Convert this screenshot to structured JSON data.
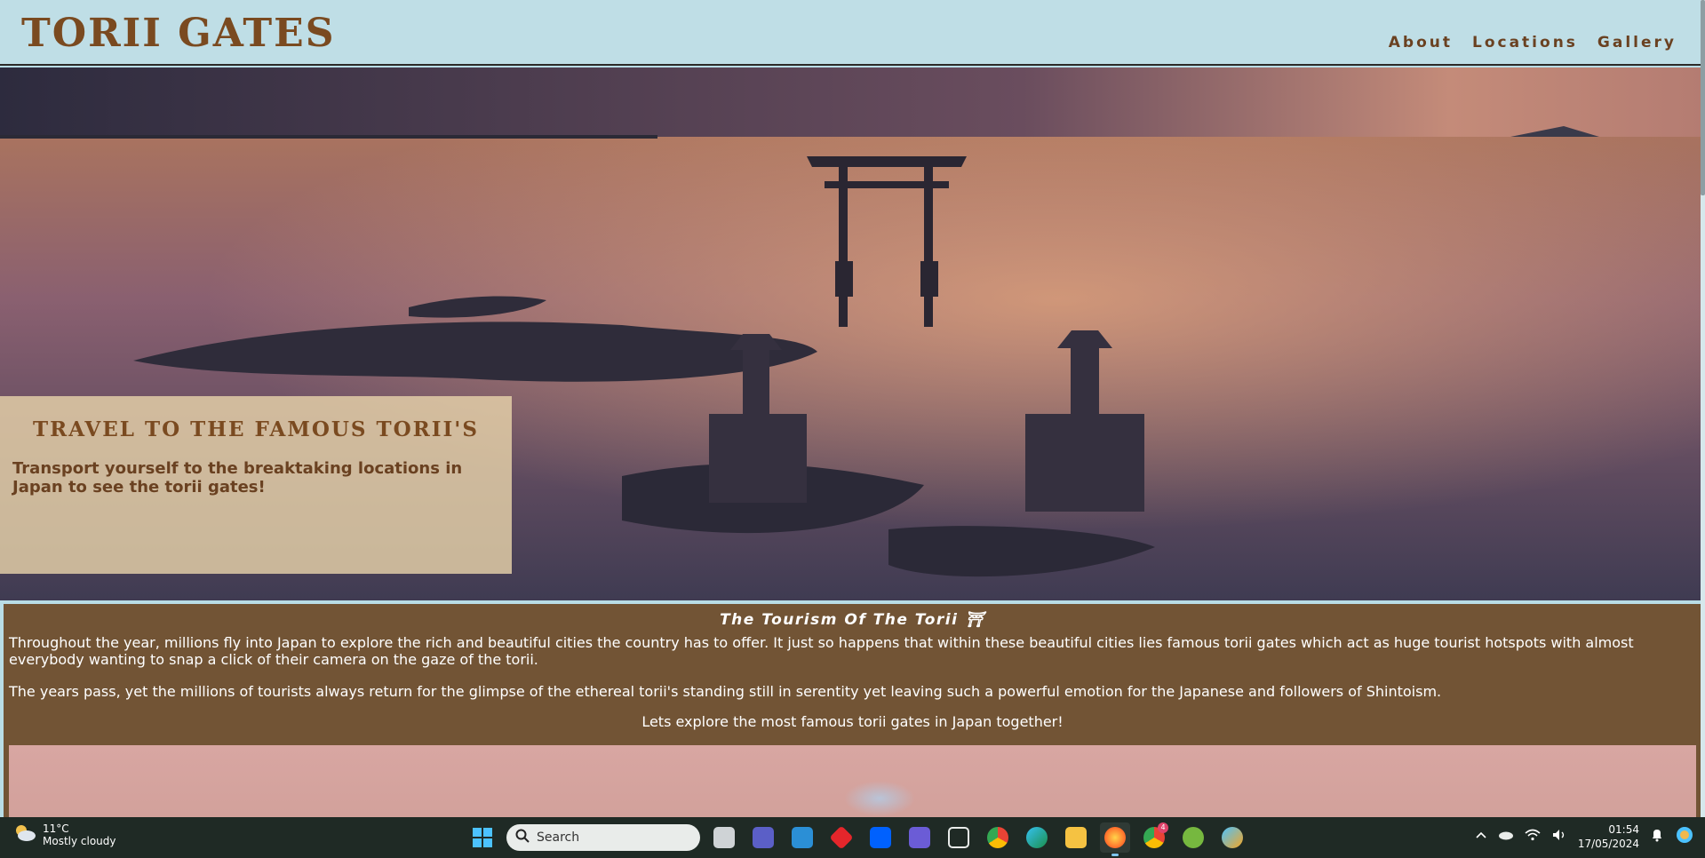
{
  "site": {
    "brand": "TORII GATES"
  },
  "nav": {
    "items": [
      "About",
      "Locations",
      "Gallery"
    ]
  },
  "hero": {
    "title": "TRAVEL TO THE FAMOUS TORII'S",
    "subtitle": "Transport yourself to the breaktaking locations in Japan to see the torii gates!"
  },
  "section": {
    "title": "The Tourism Of The Torii ⛩",
    "para1": "Throughout the year, millions fly into Japan to explore the rich and beautiful cities the country has to offer. It just so happens that within these beautiful cities lies famous torii gates which act as huge tourist hotspots with almost everybody wanting to snap a click of their camera on the gaze of the torii.",
    "para2": "The years pass, yet the millions of tourists always return for the glimpse of the ethereal torii's standing still in serentity yet leaving such a powerful emotion for the Japanese and followers of Shintoism.",
    "cta": "Lets explore the most famous torii gates in Japan together!"
  },
  "taskbar": {
    "weather_temp": "11°C",
    "weather_desc": "Mostly cloudy",
    "search_placeholder": "Search",
    "chrome_badge": "4",
    "time": "01:54",
    "date": "17/05/2024"
  },
  "colors": {
    "header_bg": "#bfdee6",
    "brand": "#7a4a20",
    "section_bg": "#725435",
    "taskbar_bg": "#1f2a25"
  }
}
